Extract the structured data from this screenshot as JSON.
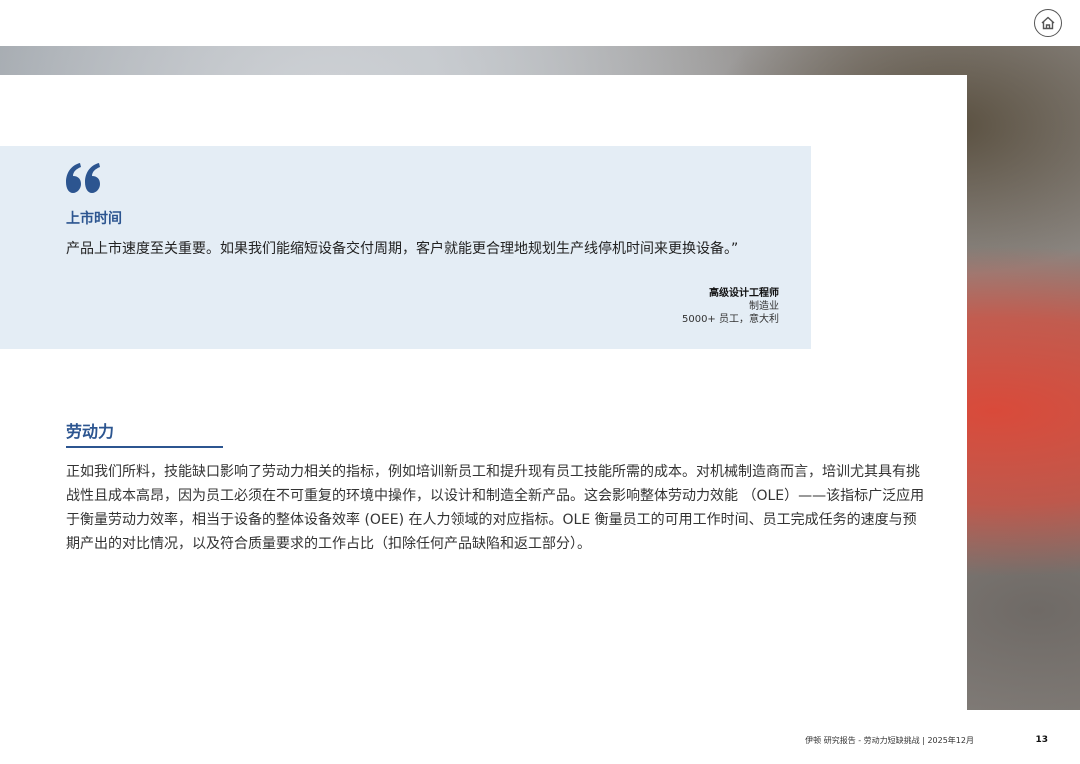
{
  "quote": {
    "title": "上市时间",
    "text": "产品上市速度至关重要。如果我们能缩短设备交付周期，客户就能更合理地规划生产线停机时间来更换设备。”",
    "role": "高级设计工程师",
    "industry": "制造业",
    "company": "5000+ 员工，意大利",
    "accent_color": "#2c5590",
    "background_color": "#e4edf5"
  },
  "section": {
    "title": "劳动力",
    "body": "正如我们所料，技能缺口影响了劳动力相关的指标，例如培训新员工和提升现有员工技能所需的成本。对机械制造商而言，培训尤其具有挑战性且成本高昂，因为员工必须在不可重复的环境中操作，以设计和制造全新产品。这会影响整体劳动力效能 （OLE）——该指标广泛应用于衡量劳动力效率，相当于设备的整体设备效率 (OEE) 在人力领域的对应指标。OLE 衡量员工的可用工作时间、员工完成任务的速度与预期产出的对比情况，以及符合质量要求的工作占比（扣除任何产品缺陷和返工部分）。"
  },
  "footer": {
    "text": "伊顿 研究报告 - 劳动力短缺挑战 | 2025年12月",
    "page_number": "13"
  },
  "icons": {
    "home": "home-icon",
    "quote": "quote-mark-icon"
  }
}
